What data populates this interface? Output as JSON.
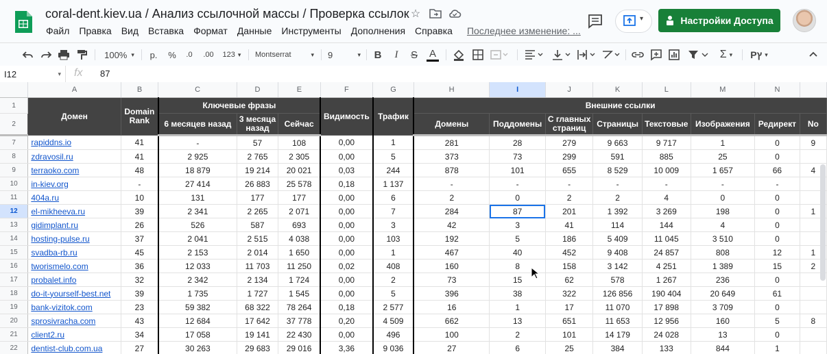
{
  "doc": {
    "title": "coral-dent.kiev.ua / Анализ ссылочной массы / Проверка ссылок",
    "menu": [
      "Файл",
      "Правка",
      "Вид",
      "Вставка",
      "Формат",
      "Данные",
      "Инструменты",
      "Дополнения",
      "Справка"
    ],
    "last_edit": "Последнее изменение: ...",
    "share_label": "Настройки Доступа"
  },
  "toolbar": {
    "zoom": "100%",
    "currency": "р.",
    "percent": "%",
    "dec_less": ".0",
    "dec_more": ".00",
    "format_more": "123",
    "font": "Montserrat",
    "font_size": "9",
    "bold": "B",
    "italic": "I",
    "strike": "S",
    "text_color": "A",
    "input_tools": "Рץ"
  },
  "formula": {
    "cell": "I12",
    "value": "87"
  },
  "colors": {
    "accent": "#1a73e8",
    "share": "#188038",
    "header_bg": "#434343",
    "link": "#1155cc"
  },
  "sheet": {
    "columns": [
      "A",
      "B",
      "C",
      "D",
      "E",
      "F",
      "G",
      "H",
      "I",
      "J",
      "K",
      "L",
      "M",
      "N",
      ""
    ],
    "selected_column": "I",
    "header_row1": {
      "domain": "Домен",
      "rank": "Domain Rank",
      "keyphrases": "Ключевые фразы",
      "visibility": "Видимость",
      "traffic": "Трафик",
      "external": "Внешние ссылки"
    },
    "header_row2": [
      "6 месяцев назад",
      "3 месяца назад",
      "Сейчас",
      "Домены",
      "Поддомены",
      "С главных страниц",
      "Страницы",
      "Текстовые",
      "Изображения",
      "Редирект",
      "No"
    ],
    "rows": [
      {
        "n": "7",
        "d": [
          "rapiddns.io",
          "41",
          "-",
          "57",
          "108",
          "0,00",
          "1",
          "281",
          "28",
          "279",
          "9 663",
          "9 717",
          "1",
          "0",
          "9"
        ]
      },
      {
        "n": "8",
        "d": [
          "zdravosil.ru",
          "41",
          "2 925",
          "2 765",
          "2 305",
          "0,00",
          "5",
          "373",
          "73",
          "299",
          "591",
          "885",
          "25",
          "0",
          ""
        ]
      },
      {
        "n": "9",
        "d": [
          "terraoko.com",
          "48",
          "18 879",
          "19 214",
          "20 021",
          "0,03",
          "244",
          "878",
          "101",
          "655",
          "8 529",
          "10 009",
          "1 657",
          "66",
          "4"
        ]
      },
      {
        "n": "10",
        "d": [
          "in-kiev.org",
          "-",
          "27 414",
          "26 883",
          "25 578",
          "0,18",
          "1 137",
          "-",
          "-",
          "-",
          "-",
          "-",
          "-",
          "-",
          ""
        ]
      },
      {
        "n": "11",
        "d": [
          "404a.ru",
          "10",
          "131",
          "177",
          "177",
          "0,00",
          "6",
          "2",
          "0",
          "2",
          "2",
          "4",
          "0",
          "0",
          ""
        ]
      },
      {
        "n": "12",
        "d": [
          "el-mikheeva.ru",
          "39",
          "2 341",
          "2 265",
          "2 071",
          "0,00",
          "7",
          "284",
          "87",
          "201",
          "1 392",
          "3 269",
          "198",
          "0",
          "1"
        ]
      },
      {
        "n": "13",
        "d": [
          "gidimplant.ru",
          "26",
          "526",
          "587",
          "693",
          "0,00",
          "3",
          "42",
          "3",
          "41",
          "114",
          "144",
          "4",
          "0",
          ""
        ]
      },
      {
        "n": "14",
        "d": [
          "hosting-pulse.ru",
          "37",
          "2 041",
          "2 515",
          "4 038",
          "0,00",
          "103",
          "192",
          "5",
          "186",
          "5 409",
          "11 045",
          "3 510",
          "0",
          ""
        ]
      },
      {
        "n": "15",
        "d": [
          "svadba-rb.ru",
          "45",
          "2 153",
          "2 014",
          "1 650",
          "0,00",
          "1",
          "467",
          "40",
          "452",
          "9 408",
          "24 857",
          "808",
          "12",
          "1"
        ]
      },
      {
        "n": "16",
        "d": [
          "tworismelo.com",
          "36",
          "12 033",
          "11 703",
          "11 250",
          "0,02",
          "408",
          "160",
          "8",
          "158",
          "3 142",
          "4 251",
          "1 389",
          "15",
          "2"
        ]
      },
      {
        "n": "17",
        "d": [
          "probalet.info",
          "32",
          "2 342",
          "2 134",
          "1 724",
          "0,00",
          "2",
          "73",
          "15",
          "62",
          "578",
          "1 267",
          "236",
          "0",
          ""
        ]
      },
      {
        "n": "18",
        "d": [
          "do-it-yourself-best.net",
          "39",
          "1 735",
          "1 727",
          "1 545",
          "0,00",
          "5",
          "396",
          "38",
          "322",
          "126 856",
          "190 404",
          "20 649",
          "61",
          ""
        ]
      },
      {
        "n": "19",
        "d": [
          "bank-vizitok.com",
          "23",
          "59 382",
          "68 322",
          "78 264",
          "0,18",
          "2 577",
          "16",
          "1",
          "17",
          "11 070",
          "17 898",
          "3 709",
          "0",
          ""
        ]
      },
      {
        "n": "20",
        "d": [
          "sprosivracha.com",
          "43",
          "12 684",
          "17 642",
          "37 778",
          "0,20",
          "4 509",
          "662",
          "13",
          "651",
          "11 653",
          "12 956",
          "160",
          "5",
          "8"
        ]
      },
      {
        "n": "21",
        "d": [
          "client2.ru",
          "34",
          "17 058",
          "19 141",
          "22 430",
          "0,00",
          "496",
          "100",
          "2",
          "101",
          "14 179",
          "24 028",
          "13",
          "0",
          ""
        ]
      },
      {
        "n": "22",
        "d": [
          "dentist-club.com.ua",
          "27",
          "30 263",
          "29 683",
          "29 016",
          "3,36",
          "9 036",
          "27",
          "6",
          "25",
          "384",
          "133",
          "844",
          "1",
          ""
        ]
      }
    ],
    "selected": {
      "row": "12",
      "col": 8
    }
  }
}
